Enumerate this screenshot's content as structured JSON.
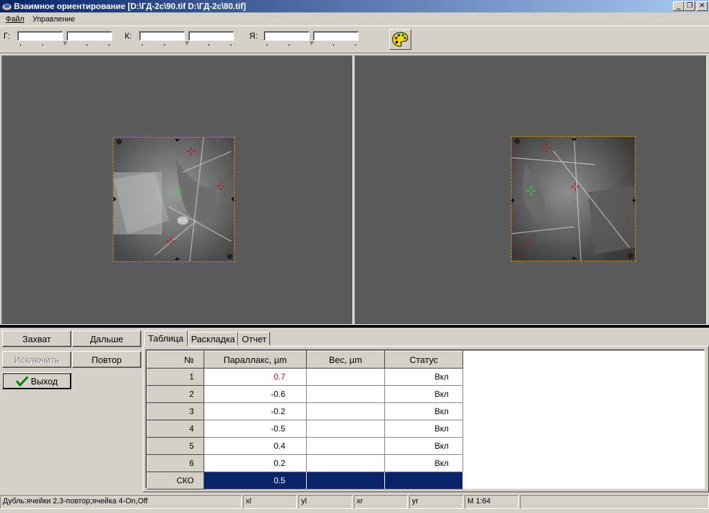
{
  "window": {
    "title": "Взаимное ориентирование [D:\\ГД-2с\\90.tif  D:\\ГД-2с\\80.tif]",
    "minimize": "_",
    "restore": "❐",
    "close": "✕"
  },
  "menu": {
    "file": "Файл",
    "control": "Управление"
  },
  "toolbar": {
    "g_label": "Г:",
    "k_label": "К:",
    "ya_label": "Я:"
  },
  "buttons": {
    "capture": "Захват",
    "next": "Дальше",
    "exclude": "Исключить",
    "repeat": "Повтор",
    "exit": "Выход"
  },
  "tabs": [
    "Таблица",
    "Раскладка",
    "Отчет"
  ],
  "table": {
    "headers": [
      "№",
      "Параллакс, µm",
      "Вес, µm",
      "Статус"
    ],
    "rows": [
      {
        "n": "1",
        "parallax": "0.7",
        "weight": "",
        "status": "Вкл"
      },
      {
        "n": "2",
        "parallax": "-0.6",
        "weight": "",
        "status": "Вкл"
      },
      {
        "n": "3",
        "parallax": "-0.2",
        "weight": "",
        "status": "Вкл"
      },
      {
        "n": "4",
        "parallax": "-0.5",
        "weight": "",
        "status": "Вкл"
      },
      {
        "n": "5",
        "parallax": "0.4",
        "weight": "",
        "status": "Вкл"
      },
      {
        "n": "6",
        "parallax": "0.2",
        "weight": "",
        "status": "Вкл"
      }
    ],
    "summary": {
      "label": "СКО",
      "parallax": "0.5",
      "weight": "",
      "status": ""
    }
  },
  "statusbar": {
    "message": "Дубль:ячейки 2,3-повтор;ячейка 4-On,Off",
    "xl": "xl",
    "yl": "yl",
    "xr": "xr",
    "yr": "yr",
    "scale": "M  1:64",
    "extra": ""
  },
  "colors": {
    "title_start": "#0a246a",
    "title_end": "#a6caf0",
    "pane_bg": "#5b5b5b",
    "frame_border": "#e08a00",
    "selection": "#0a246a",
    "highlight_value": "#d00000"
  }
}
